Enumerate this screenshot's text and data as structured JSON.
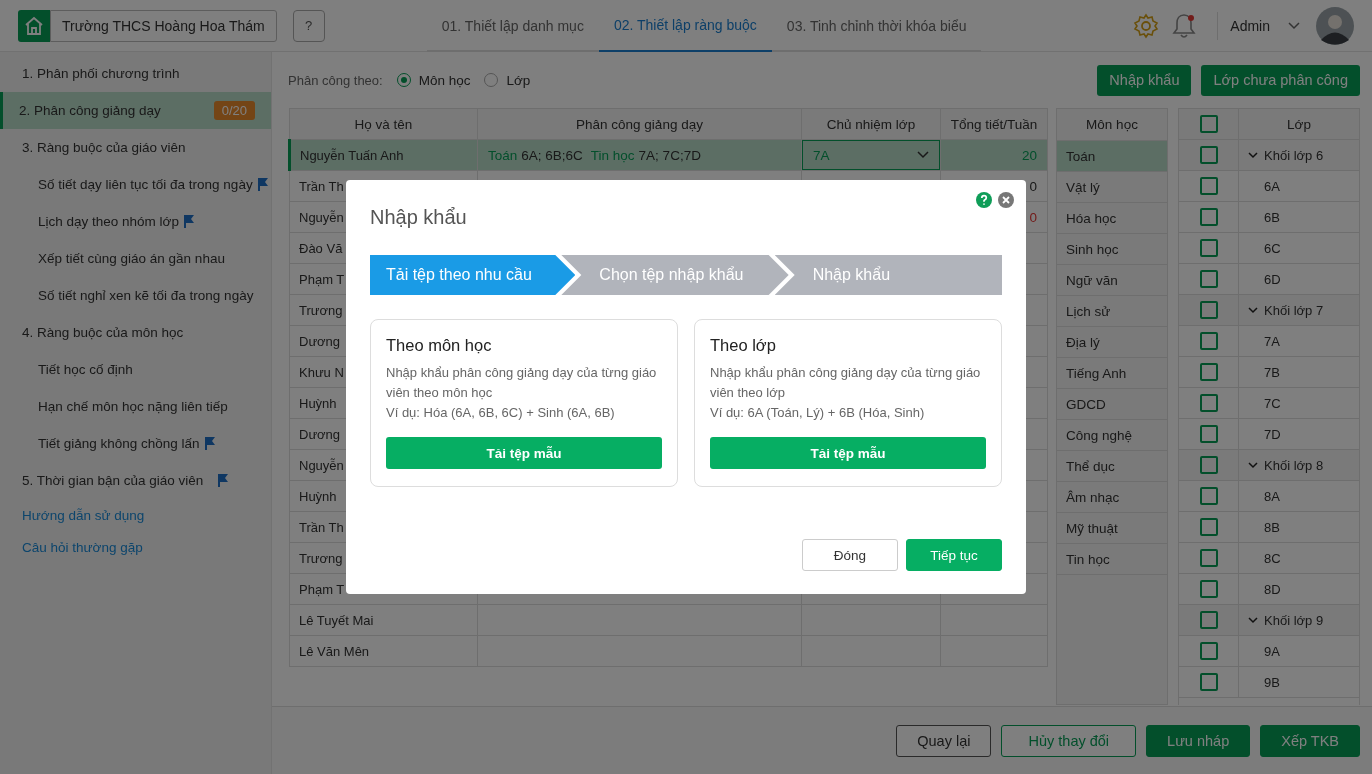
{
  "header": {
    "school": "Trường THCS Hoàng Hoa Thám",
    "help": "?",
    "tabs": [
      {
        "label": "01. Thiết lập danh mục",
        "selected": false
      },
      {
        "label": "02. Thiết lập ràng buộc",
        "selected": true
      },
      {
        "label": "03. Tinh chỉnh thời khóa biểu",
        "selected": false
      }
    ],
    "notification_unread": true,
    "user": "Admin"
  },
  "sidebar": {
    "items": [
      {
        "kind": "section",
        "label": "1. Phân phối chương trình",
        "selected": false,
        "flagged": false
      },
      {
        "kind": "section",
        "label": "2. Phân công giảng dạy",
        "selected": true,
        "flagged": false,
        "badge": "0/20"
      },
      {
        "kind": "section",
        "label": "3. Ràng buộc của giáo viên",
        "selected": false,
        "flagged": false
      },
      {
        "kind": "sub",
        "label": "Số tiết dạy liên tục tối đa trong ngày",
        "selected": false,
        "flagged": true
      },
      {
        "kind": "sub",
        "label": "Lịch dạy theo nhóm lớp",
        "selected": false,
        "flagged": true
      },
      {
        "kind": "sub",
        "label": "Xếp tiết cùng giáo án gần nhau",
        "selected": false,
        "flagged": false
      },
      {
        "kind": "sub",
        "label": "Số tiết nghỉ xen kẽ tối đa trong ngày",
        "selected": false,
        "flagged": false
      },
      {
        "kind": "section",
        "label": "4. Ràng buộc của môn học",
        "selected": false,
        "flagged": false
      },
      {
        "kind": "sub",
        "label": "Tiết học cố định",
        "selected": false,
        "flagged": false
      },
      {
        "kind": "sub",
        "label": "Hạn chế môn học nặng liên tiếp",
        "selected": false,
        "flagged": false
      },
      {
        "kind": "sub",
        "label": "Tiết giảng không chồng lấn",
        "selected": false,
        "flagged": true
      },
      {
        "kind": "section",
        "label": "5. Thời gian bận của giáo viên",
        "selected": false,
        "flagged": true
      },
      {
        "kind": "link",
        "label": "Hướng dẫn sử dụng",
        "selected": false,
        "flagged": false
      },
      {
        "kind": "link",
        "label": "Câu hỏi thường gặp",
        "selected": false,
        "flagged": false
      }
    ]
  },
  "toolbar": {
    "label": "Phân công theo:",
    "options": [
      {
        "label": "Môn học",
        "selected": true
      },
      {
        "label": "Lớp",
        "selected": false
      }
    ],
    "buttons": [
      "Nhập khẩu",
      "Lớp chưa phân công"
    ]
  },
  "table": {
    "columns": [
      "Họ và tên",
      "Phân công giảng dạy",
      "Chủ nhiệm lớp",
      "Tổng tiết/Tuần"
    ],
    "rows": [
      {
        "name": "Nguyễn Tuấn Anh",
        "selected": true,
        "assignments": [
          {
            "subject": "Toán",
            "classes": "6A; 6B;6C"
          },
          {
            "subject": "Tin học",
            "classes": "7A; 7C;7D"
          }
        ],
        "homeroom": "7A",
        "total": "20",
        "over_limit": false
      },
      {
        "name": "Trần Th",
        "selected": false,
        "total": "0",
        "over_limit": false
      },
      {
        "name": "Nguyễn",
        "selected": false,
        "total": "0",
        "over_limit": true
      },
      {
        "name": "Đào Vă",
        "selected": false
      },
      {
        "name": "Phạm T",
        "selected": false
      },
      {
        "name": "Trương",
        "selected": false
      },
      {
        "name": "Dương",
        "selected": false
      },
      {
        "name": "Khưu N",
        "selected": false
      },
      {
        "name": "Huỳnh",
        "selected": false
      },
      {
        "name": "Dương",
        "selected": false
      },
      {
        "name": "Nguyễn",
        "selected": false
      },
      {
        "name": "Huỳnh",
        "selected": false
      },
      {
        "name": "Trần Th",
        "selected": false
      },
      {
        "name": "Trương",
        "selected": false
      },
      {
        "name": "Phạm T",
        "selected": false
      },
      {
        "name": "Lê Tuyết Mai",
        "selected": false
      },
      {
        "name": "Lê Văn Mên",
        "selected": false
      }
    ]
  },
  "subjects": {
    "title": "Môn học",
    "items": [
      {
        "name": "Toán",
        "selected": true
      },
      {
        "name": "Vật lý",
        "selected": false
      },
      {
        "name": "Hóa học",
        "selected": false
      },
      {
        "name": "Sinh học",
        "selected": false
      },
      {
        "name": "Ngữ văn",
        "selected": false
      },
      {
        "name": "Lịch sử",
        "selected": false
      },
      {
        "name": "Địa lý",
        "selected": false
      },
      {
        "name": "Tiếng Anh",
        "selected": false
      },
      {
        "name": "GDCD",
        "selected": false
      },
      {
        "name": "Công nghệ",
        "selected": false
      },
      {
        "name": "Thể dục",
        "selected": false
      },
      {
        "name": "Âm nhạc",
        "selected": false
      },
      {
        "name": "Mỹ thuật",
        "selected": false
      },
      {
        "name": "Tin học",
        "selected": false
      }
    ]
  },
  "classes": {
    "title": "Lớp",
    "all_checked": false,
    "groups": [
      {
        "name": "Khối lớp 6",
        "expanded": true,
        "checked": false,
        "children": [
          {
            "name": "6A",
            "checked": false
          },
          {
            "name": "6B",
            "checked": false
          },
          {
            "name": "6C",
            "checked": false
          },
          {
            "name": "6D",
            "checked": false
          }
        ]
      },
      {
        "name": "Khối lớp 7",
        "expanded": true,
        "checked": false,
        "children": [
          {
            "name": "7A",
            "checked": false
          },
          {
            "name": "7B",
            "checked": false
          },
          {
            "name": "7C",
            "checked": false
          },
          {
            "name": "7D",
            "checked": false
          }
        ]
      },
      {
        "name": "Khối lớp 8",
        "expanded": true,
        "checked": false,
        "children": [
          {
            "name": "8A",
            "checked": false
          },
          {
            "name": "8B",
            "checked": false
          },
          {
            "name": "8C",
            "checked": false
          },
          {
            "name": "8D",
            "checked": false
          }
        ]
      },
      {
        "name": "Khối lớp 9",
        "expanded": true,
        "checked": false,
        "children": [
          {
            "name": "9A",
            "checked": false
          },
          {
            "name": "9B",
            "checked": false
          }
        ]
      }
    ]
  },
  "footer": {
    "buttons": [
      {
        "label": "Quay lại",
        "kind": "secondary"
      },
      {
        "label": "Hủy thay đổi",
        "kind": "outline"
      },
      {
        "label": "Lưu nháp",
        "kind": "primary"
      },
      {
        "label": "Xếp TKB",
        "kind": "primary"
      }
    ]
  },
  "dialog": {
    "title": "Nhập khẩu",
    "steps": [
      {
        "label": "Tải tệp theo nhu cầu",
        "selected": true
      },
      {
        "label": "Chọn tệp nhập khẩu",
        "selected": false
      },
      {
        "label": "Nhập khẩu",
        "selected": false
      }
    ],
    "cards": [
      {
        "title": "Theo môn học",
        "description": "Nhập khẩu phân công giảng dạy của từng giáo viên theo môn học",
        "example": "Ví dụ: Hóa (6A, 6B, 6C) + Sinh (6A, 6B)",
        "button": "Tải tệp mẫu"
      },
      {
        "title": "Theo lớp",
        "description": "Nhập khẩu phân công giảng dạy của từng giáo viên theo lớp",
        "example": "Ví dụ: 6A (Toán, Lý) + 6B (Hóa, Sinh)",
        "button": "Tải tệp mẫu"
      }
    ],
    "buttons": [
      {
        "label": "Đóng",
        "kind": "secondary"
      },
      {
        "label": "Tiếp tục",
        "kind": "primary"
      }
    ]
  }
}
